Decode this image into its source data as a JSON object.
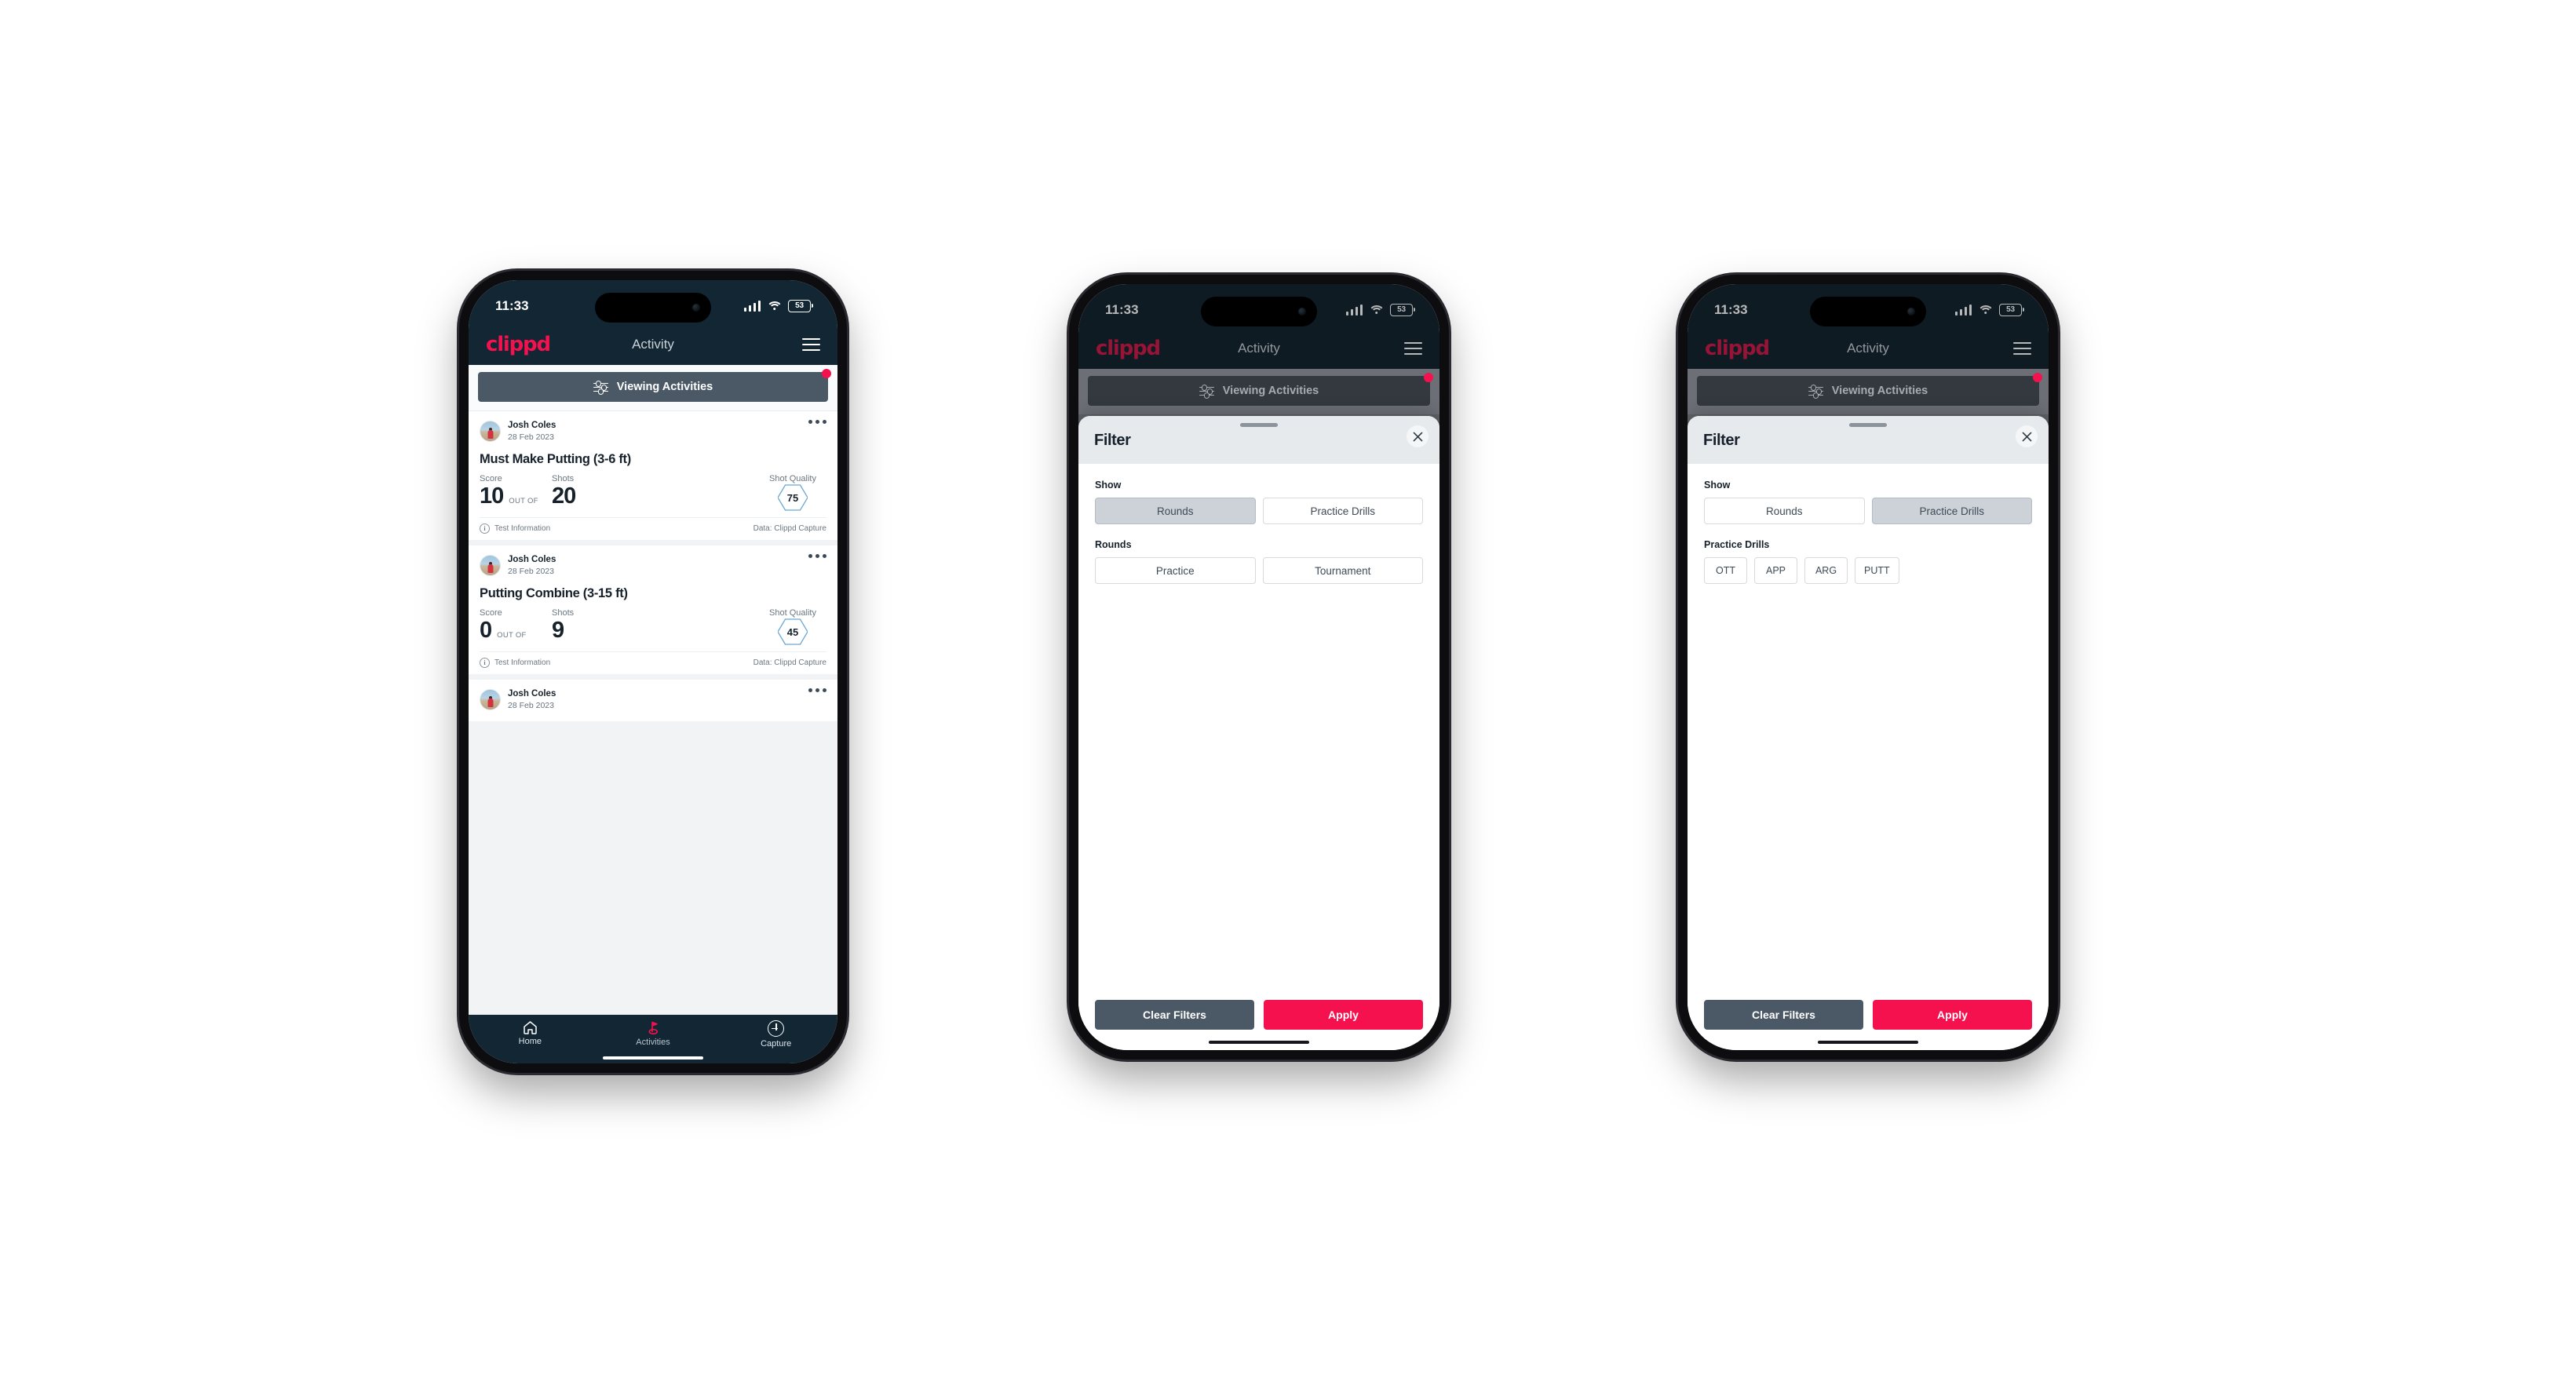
{
  "status_bar": {
    "time": "11:33",
    "battery": "53",
    "icons": [
      "cellular-signal-icon",
      "wifi-icon",
      "battery-icon"
    ]
  },
  "app_bar": {
    "logo": "clippd",
    "title": "Activity",
    "menu_icon": "hamburger-menu-icon"
  },
  "filter_bar": {
    "label": "Viewing Activities",
    "icon": "sliders-filter-icon",
    "has_badge": true
  },
  "feed": {
    "cards": [
      {
        "user": "Josh Coles",
        "date": "28 Feb 2023",
        "title": "Must Make Putting (3-6 ft)",
        "score_label": "Score",
        "shots_label": "Shots",
        "quality_label": "Shot Quality",
        "score": "10",
        "out_of": "OUT OF",
        "shots": "20",
        "quality": "75",
        "test_information": "Test Information",
        "data_source": "Data: Clippd Capture"
      },
      {
        "user": "Josh Coles",
        "date": "28 Feb 2023",
        "title": "Putting Combine (3-15 ft)",
        "score_label": "Score",
        "shots_label": "Shots",
        "quality_label": "Shot Quality",
        "score": "0",
        "out_of": "OUT OF",
        "shots": "9",
        "quality": "45",
        "test_information": "Test Information",
        "data_source": "Data: Clippd Capture"
      },
      {
        "user": "Josh Coles",
        "date": "28 Feb 2023"
      }
    ]
  },
  "bottom_nav": {
    "items": [
      {
        "label": "Home",
        "icon": "home-icon",
        "active": false
      },
      {
        "label": "Activities",
        "icon": "golf-flag-icon",
        "active": true
      },
      {
        "label": "Capture",
        "icon": "plus-circle-icon",
        "active": false
      }
    ]
  },
  "filter_sheet": {
    "title": "Filter",
    "close_icon": "close-x-icon",
    "show_label": "Show",
    "show_options": [
      "Rounds",
      "Practice Drills"
    ],
    "rounds_label": "Rounds",
    "rounds_options": [
      "Practice",
      "Tournament"
    ],
    "practice_drills_label": "Practice Drills",
    "practice_drills_options": [
      "OTT",
      "APP",
      "ARG",
      "PUTT"
    ],
    "clear_label": "Clear Filters",
    "apply_label": "Apply",
    "selected_show_phone2": "Rounds",
    "selected_show_phone3": "Practice Drills"
  },
  "colors": {
    "brand_pink": "#f4114e",
    "header_navy": "#122634",
    "slate": "#4b5966",
    "hex_blue": "#6aa7d4"
  }
}
